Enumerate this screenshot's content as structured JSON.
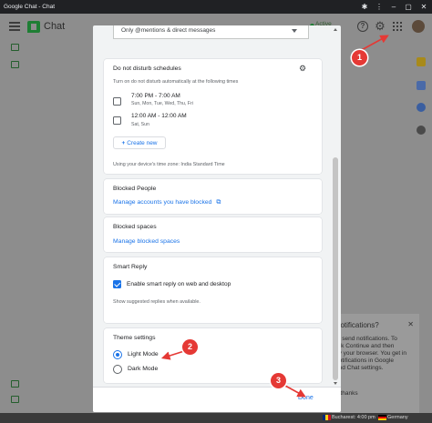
{
  "window": {
    "title": "Google Chat - Chat",
    "controls": [
      "minimize",
      "maximize",
      "close"
    ]
  },
  "app_header": {
    "app_name": "Chat",
    "status_text": "Active"
  },
  "notification_prompt": {
    "heading": "notifications?",
    "lines": [
      "to send notifications. To",
      "lick Continue and then",
      "by your browser. You get in",
      "notifications in Google",
      "and Chat settings."
    ],
    "dismiss": "o thanks"
  },
  "taskbar": {
    "location": "Bucharest: 4:00 pm",
    "country": "Germany"
  },
  "dialog": {
    "notify_dropdown": {
      "value": "Only @mentions & direct messages"
    },
    "dnd": {
      "title": "Do not disturb schedules",
      "description": "Turn on do not disturb automatically at the following times",
      "schedules": [
        {
          "time": "7:00 PM - 7:00 AM",
          "days": "Sun, Mon, Tue, Wed, Thu, Fri",
          "checked": false
        },
        {
          "time": "12:00 AM - 12:00 AM",
          "days": "Sat, Sun",
          "checked": false
        }
      ],
      "create_new": "Create new",
      "timezone_note": "Using your device's time zone: India Standard Time"
    },
    "blocked_people": {
      "title": "Blocked People",
      "link": "Manage accounts you have blocked"
    },
    "blocked_spaces": {
      "title": "Blocked spaces",
      "link": "Manage blocked spaces"
    },
    "smart_reply": {
      "title": "Smart Reply",
      "option": "Enable smart reply on web and desktop",
      "checked": true,
      "note": "Show suggested replies when available."
    },
    "theme": {
      "title": "Theme settings",
      "options": [
        {
          "label": "Light Mode",
          "selected": true
        },
        {
          "label": "Dark Mode",
          "selected": false
        }
      ]
    },
    "done_label": "Done"
  },
  "annotations": {
    "markers": [
      "1",
      "2",
      "3"
    ],
    "color": "#e53935"
  },
  "colors": {
    "accent": "#1a73e8",
    "brand": "#1e7e34"
  }
}
